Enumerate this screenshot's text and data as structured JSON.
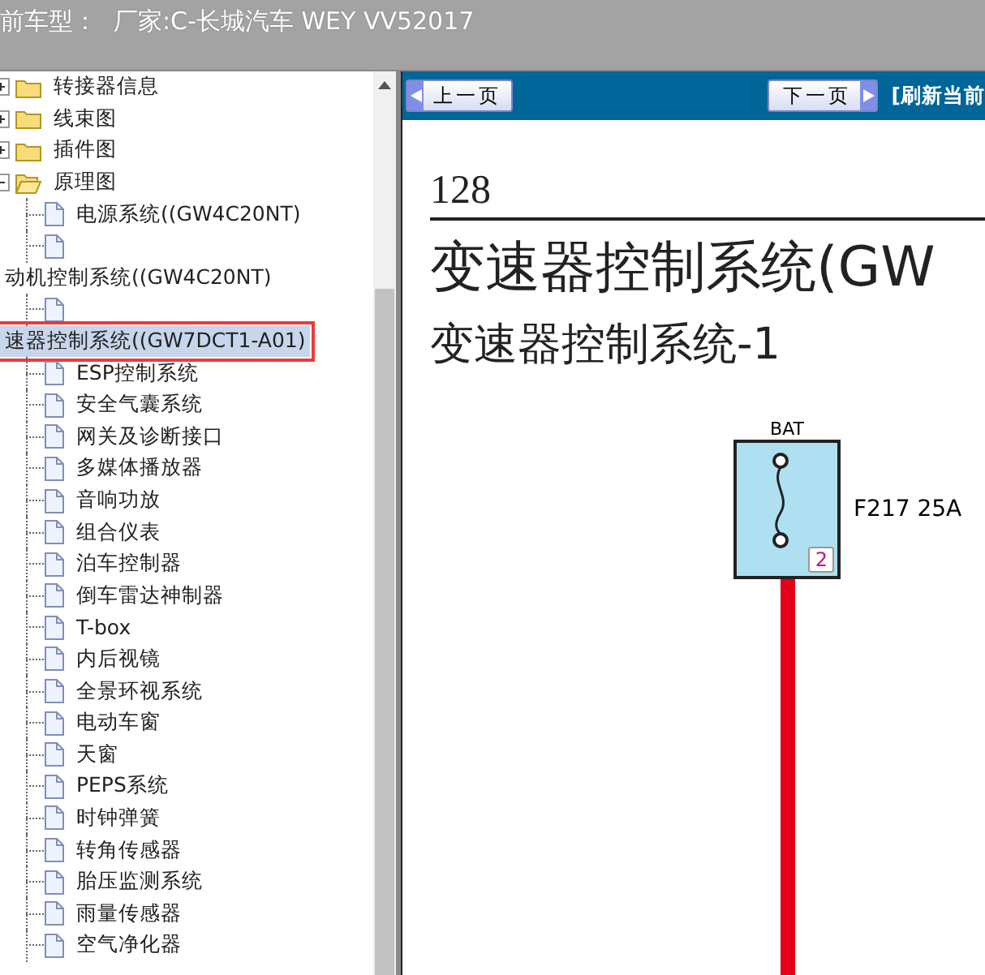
{
  "header": {
    "model_label": "前车型：",
    "model_value": "厂家:C-长城汽车 WEY VV52017"
  },
  "tree": {
    "items": [
      {
        "label": "转接器信息",
        "expanded": false
      },
      {
        "label": "线束图",
        "expanded": false
      },
      {
        "label": "插件图",
        "expanded": false
      },
      {
        "label": "原理图",
        "expanded": true,
        "children": [
          {
            "label": "电源系统((GW4C20NT)",
            "kind": "inline",
            "selected": false
          },
          {
            "label": "动机控制系统((GW4C20NT)",
            "kind": "wrapped",
            "selected": false
          },
          {
            "label": "速器控制系统((GW7DCT1-A01)",
            "kind": "wrapped",
            "selected": true
          },
          {
            "label": "ESP控制系统",
            "kind": "inline",
            "selected": false
          },
          {
            "label": "安全气囊系统",
            "kind": "inline",
            "selected": false
          },
          {
            "label": "网关及诊断接口",
            "kind": "inline",
            "selected": false
          },
          {
            "label": "多媒体播放器",
            "kind": "inline",
            "selected": false
          },
          {
            "label": "音响功放",
            "kind": "inline",
            "selected": false
          },
          {
            "label": "组合仪表",
            "kind": "inline",
            "selected": false
          },
          {
            "label": "泊车控制器",
            "kind": "inline",
            "selected": false
          },
          {
            "label": "倒车雷达神制器",
            "kind": "inline",
            "selected": false
          },
          {
            "label": "T-box",
            "kind": "inline",
            "selected": false
          },
          {
            "label": "内后视镜",
            "kind": "inline",
            "selected": false
          },
          {
            "label": "全景环视系统",
            "kind": "inline",
            "selected": false
          },
          {
            "label": "电动车窗",
            "kind": "inline",
            "selected": false
          },
          {
            "label": "天窗",
            "kind": "inline",
            "selected": false
          },
          {
            "label": "PEPS系统",
            "kind": "inline",
            "selected": false
          },
          {
            "label": "时钟弹簧",
            "kind": "inline",
            "selected": false
          },
          {
            "label": "转角传感器",
            "kind": "inline",
            "selected": false
          },
          {
            "label": "胎压监测系统",
            "kind": "inline",
            "selected": false
          },
          {
            "label": "雨量传感器",
            "kind": "inline",
            "selected": false
          },
          {
            "label": "空气净化器",
            "kind": "inline",
            "selected": false
          }
        ]
      }
    ]
  },
  "toolbar": {
    "prev": "上一页",
    "next": "下一页",
    "refresh": "[刷新当前"
  },
  "document": {
    "page_number": "128",
    "title": "变速器控制系统(GW",
    "subtitle": "变速器控制系统-1",
    "diagram": {
      "source": "BAT",
      "fuse_label": "F217 25A",
      "pin": "2"
    }
  }
}
